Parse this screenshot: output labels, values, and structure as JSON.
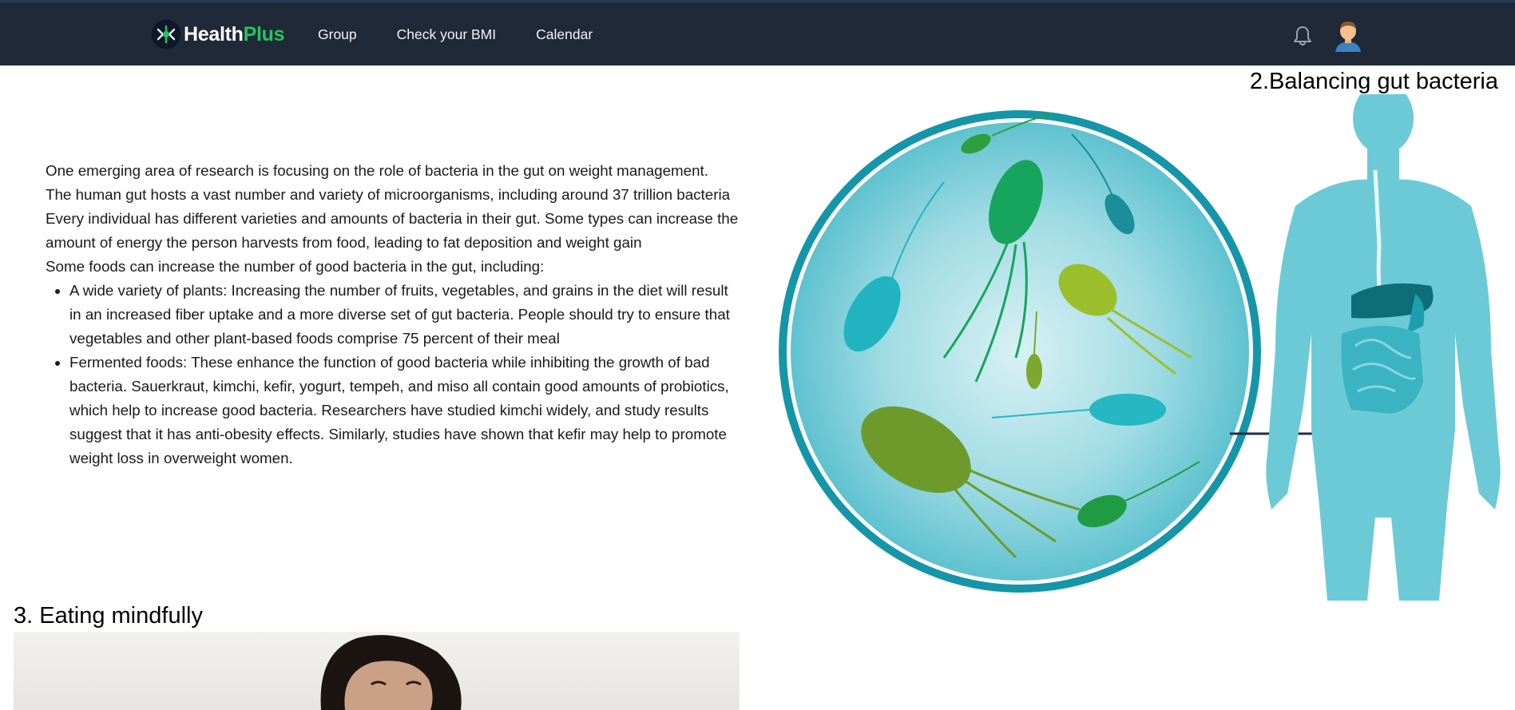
{
  "header": {
    "brand": {
      "part1": "Health",
      "part2": "Plus"
    },
    "nav": [
      "Group",
      "Check your BMI",
      "Calendar"
    ],
    "icons": {
      "notifications": "bell-icon",
      "profile": "user-avatar"
    },
    "colors": {
      "bar": "#1f2937",
      "brand_accent": "#22c55e"
    }
  },
  "section2": {
    "title": "2.Balancing gut bacteria",
    "paragraphs": [
      "One emerging area of research is focusing on the role of bacteria in the gut on weight management.",
      "The human gut hosts a vast number and variety of microorganisms, including around 37 trillion bacteria",
      "Every individual has different varieties and amounts of bacteria in their gut. Some types can increase the amount of energy the person harvests from food, leading to fat deposition and weight gain",
      "Some foods can increase the number of good bacteria in the gut, including:"
    ],
    "bullets": [
      "A wide variety of plants: Increasing the number of fruits, vegetables, and grains in the diet will result in an increased fiber uptake and a more diverse set of gut bacteria. People should try to ensure that vegetables and other plant-based foods comprise 75 percent of their meal",
      "Fermented foods: These enhance the function of good bacteria while inhibiting the growth of bad bacteria. Sauerkraut, kimchi, kefir, yogurt, tempeh, and miso all contain good amounts of probiotics, which help to increase good bacteria. Researchers have studied kimchi widely, and study results suggest that it has anti-obesity effects. Similarly, studies have shown that kefir may help to promote weight loss in overweight women."
    ]
  },
  "section3": {
    "title": "3. Eating mindfully"
  }
}
